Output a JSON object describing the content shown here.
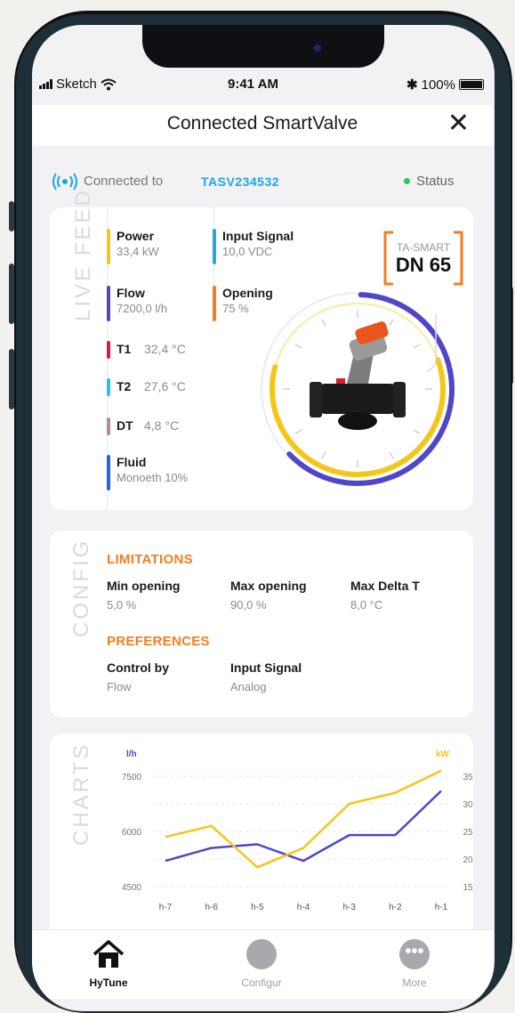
{
  "status_bar": {
    "carrier": "Sketch",
    "time": "9:41 AM",
    "battery": "100%"
  },
  "navbar": {
    "title": "Connected SmartValve",
    "close_icon": "close-icon"
  },
  "connection": {
    "prefix": "Connected to",
    "device_id": "TASV234532",
    "status": "Status"
  },
  "live_feed": {
    "label": "LIVE FEED",
    "metrics": [
      {
        "label": "Power",
        "value": "33,4 kW",
        "color": "#f5c518"
      },
      {
        "label": "Input Signal",
        "value": "10,0 VDC",
        "color": "#27a8e0"
      },
      {
        "label": "Flow",
        "value": "7200,0 l/h",
        "color": "#4f46c8"
      },
      {
        "label": "Opening",
        "value": "75 %",
        "color": "#f47d20"
      }
    ],
    "temps": [
      {
        "label": "T1",
        "value": "32,4 °C",
        "color": "#e0193b"
      },
      {
        "label": "T2",
        "value": "27,6 °C",
        "color": "#2bc0e4"
      },
      {
        "label": "DT",
        "value": "4,8 °C",
        "color": "#b58a9a"
      }
    ],
    "fluid": {
      "label": "Fluid",
      "value": "Monoeth 10%",
      "color": "#2563eb"
    },
    "badge": {
      "brand": "TA-SMART",
      "size": "DN 65"
    },
    "gauge": {
      "opening_fraction": 0.75,
      "flow_color": "#4f46c8",
      "power_color": "#f5c518"
    }
  },
  "config": {
    "label": "CONFIG",
    "limitations_title": "LIMITATIONS",
    "limitations": [
      {
        "label": "Min opening",
        "value": "5,0 %"
      },
      {
        "label": "Max opening",
        "value": "90,0 %"
      },
      {
        "label": "Max Delta T",
        "value": "8,0 °C"
      }
    ],
    "preferences_title": "PREFERENCES",
    "preferences": [
      {
        "label": "Control by",
        "value": "Flow"
      },
      {
        "label": "Input Signal",
        "value": "Analog"
      }
    ]
  },
  "chart_data": {
    "type": "line",
    "label": "CHARTS",
    "categories": [
      "h-7",
      "h-6",
      "h-5",
      "h-4",
      "h-3",
      "h-2",
      "h-1"
    ],
    "y_left": {
      "unit": "l/h",
      "ticks": [
        "7500",
        "6000",
        "4500"
      ],
      "range": [
        4500,
        7500
      ]
    },
    "y_right": {
      "unit": "kW",
      "ticks": [
        "35",
        "30",
        "25",
        "20",
        "15"
      ],
      "range": [
        15,
        35
      ]
    },
    "series": [
      {
        "axis": "left",
        "color": "#4f46c8",
        "values": [
          5200,
          5550,
          5650,
          5200,
          5900,
          5900,
          7100
        ]
      },
      {
        "axis": "right",
        "color": "#f5c518",
        "values": [
          24,
          26,
          18.5,
          22,
          30,
          32,
          36
        ]
      }
    ],
    "grid": true
  },
  "tabbar": {
    "items": [
      {
        "label": "HyTune",
        "icon": "home-icon",
        "active": true
      },
      {
        "label": "Configur",
        "icon": "circle-icon",
        "active": false
      },
      {
        "label": "More",
        "icon": "more-icon",
        "active": false
      }
    ]
  }
}
